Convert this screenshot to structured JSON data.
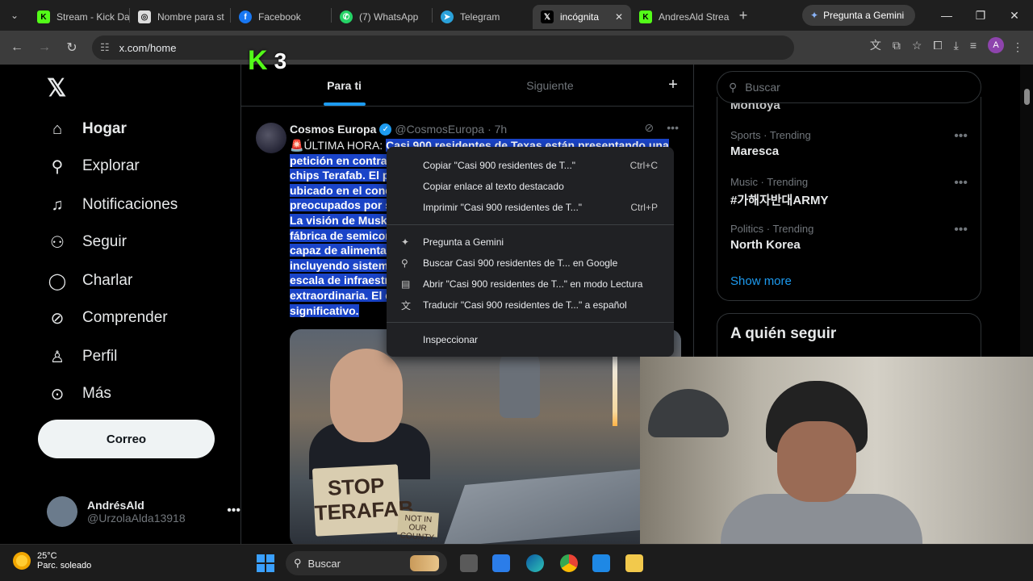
{
  "browser": {
    "tabs": [
      {
        "title": "Stream - Kick Da",
        "favicon": "kick-icon",
        "color": "#53fc18",
        "glyph": "K"
      },
      {
        "title": "Nombre para st",
        "favicon": "chatgpt-icon",
        "color": "#cccccc",
        "glyph": "◎"
      },
      {
        "title": "Facebook",
        "favicon": "facebook-icon",
        "color": "#1877f2",
        "glyph": "f"
      },
      {
        "title": "(7) WhatsApp",
        "favicon": "whatsapp-icon",
        "color": "#25d366",
        "glyph": "✆"
      },
      {
        "title": "Telegram",
        "favicon": "telegram-icon",
        "color": "#2aa1da",
        "glyph": "➤"
      },
      {
        "title": "incógnita",
        "favicon": "x-icon",
        "color": "#000000",
        "glyph": "𝕏",
        "active": true
      },
      {
        "title": "AndresAld Strea",
        "favicon": "kick-icon",
        "color": "#53fc18",
        "glyph": "K"
      }
    ],
    "gemini_button": "Pregunta a Gemini",
    "url": "x.com/home"
  },
  "overlay": {
    "kick_count": "3"
  },
  "nav": {
    "items": [
      {
        "label": "Hogar",
        "icon": "home-icon",
        "glyph": "⌂"
      },
      {
        "label": "Explorar",
        "icon": "search-icon",
        "glyph": "⚲"
      },
      {
        "label": "Notificaciones",
        "icon": "bell-icon",
        "glyph": "🔔"
      },
      {
        "label": "Seguir",
        "icon": "follow-icon",
        "glyph": "👤"
      },
      {
        "label": "Charlar",
        "icon": "chat-icon",
        "glyph": "💬"
      },
      {
        "label": "Comprender",
        "icon": "grok-icon",
        "glyph": "⊘"
      },
      {
        "label": "Perfil",
        "icon": "profile-icon",
        "glyph": "👤"
      },
      {
        "label": "Más",
        "icon": "more-icon",
        "glyph": "⋯"
      }
    ],
    "post_button": "Correo",
    "user": {
      "name": "AndrésAld",
      "handle": "@UrzolaAlda13918"
    }
  },
  "timeline": {
    "tabs": [
      "Para ti",
      "Siguiente"
    ],
    "tweet": {
      "author": "Cosmos Europa",
      "handle": "@CosmosEuropa",
      "time": "· 7h",
      "prefix": "ÚLTIMA HORA: ",
      "lines": [
        "Casi 900 residentes de Texas están presentando una",
        "petición en contra",
        "chips Terafab. El pr",
        "ubicado en el cond",
        "preocupados por s",
        "La visión de Musk p",
        "fábrica de semicor",
        "capaz de alimentar",
        "incluyendo sistema",
        "escala de infraestr",
        "extraordinaria. El d",
        "significativo."
      ],
      "image_sign": "STOP TERAFAB",
      "image_small_sign": "NOT IN OUR COUNTY"
    }
  },
  "right": {
    "search_placeholder": "Buscar",
    "cut_trend": "Montoya",
    "trends": [
      {
        "meta": "Sports · Trending",
        "name": "Maresca"
      },
      {
        "meta": "Music · Trending",
        "name": "#가해자반대ARMY"
      },
      {
        "meta": "Politics · Trending",
        "name": "North Korea"
      }
    ],
    "show_more": "Show more",
    "who_to_follow": "A quién seguir"
  },
  "context_menu": {
    "items": [
      {
        "label": "Copiar \"Casi 900 residentes de T...\"",
        "shortcut": "Ctrl+C",
        "icon": ""
      },
      {
        "label": "Copiar enlace al texto destacado",
        "shortcut": "",
        "icon": ""
      },
      {
        "label": "Imprimir \"Casi 900 residentes de T...\"",
        "shortcut": "Ctrl+P",
        "icon": ""
      },
      {
        "label": "Pregunta a Gemini",
        "shortcut": "",
        "icon": "gemini-icon"
      },
      {
        "label": "Buscar Casi 900 residentes de T... en Google",
        "shortcut": "",
        "icon": "search-icon"
      },
      {
        "label": "Abrir \"Casi 900 residentes de T...\" en modo Lectura",
        "shortcut": "",
        "icon": "reader-icon"
      },
      {
        "label": "Traducir \"Casi 900 residentes de T...\" a español",
        "shortcut": "",
        "icon": "translate-icon"
      },
      {
        "label": "Inspeccionar",
        "shortcut": "",
        "icon": ""
      }
    ]
  },
  "taskbar": {
    "temperature": "25°C",
    "weather": "Parc. soleado",
    "search": "Buscar"
  }
}
